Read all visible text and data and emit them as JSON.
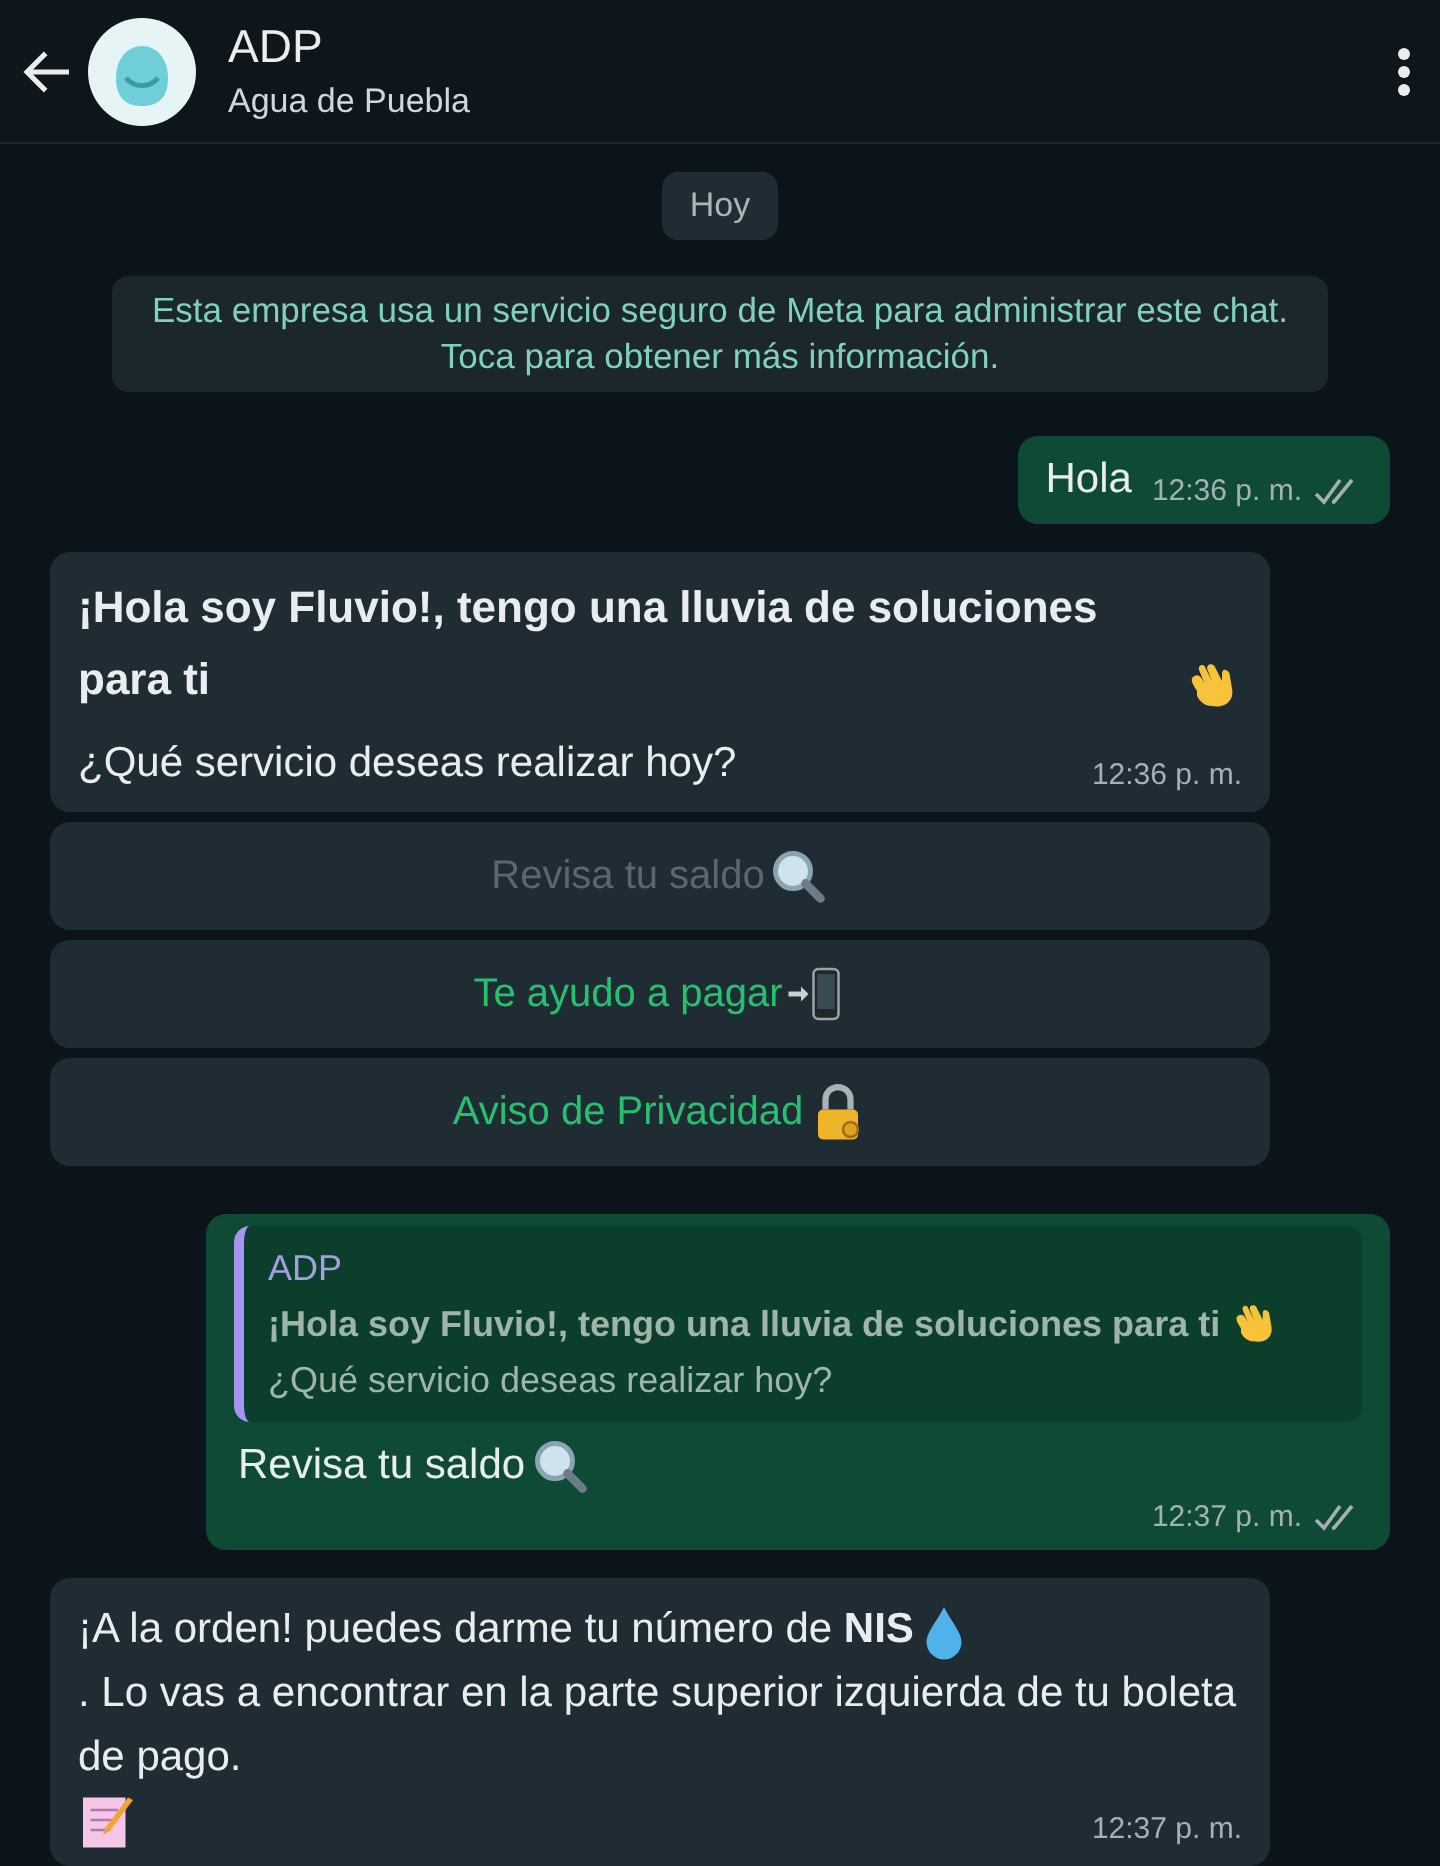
{
  "header": {
    "title": "ADP",
    "subtitle": "Agua de Puebla"
  },
  "date_chip": "Hoy",
  "notice": "Esta empresa usa un servicio seguro de Meta para administrar este chat. Toca para obtener más información.",
  "messages": [
    {
      "kind": "outgoing",
      "parts": [
        {
          "kind": "text",
          "text": "Hola"
        }
      ],
      "time": "12:36 p. m.",
      "read": false
    },
    {
      "kind": "incoming",
      "title_parts": [
        {
          "kind": "text",
          "text": "¡Hola soy Fluvio!, tengo una lluvia de soluciones para ti"
        },
        {
          "kind": "wave"
        }
      ],
      "parts": [
        {
          "kind": "text",
          "text": "¿Qué servicio deseas realizar hoy?"
        }
      ],
      "time": "12:36 p. m."
    },
    {
      "kind": "buttons",
      "buttons": [
        {
          "label": "Revisa tu saldo",
          "kind": "magnifier",
          "disabled": true
        },
        {
          "label": "Te ayudo a pagar",
          "kind": "phone",
          "disabled": false
        },
        {
          "label": "Aviso de Privacidad",
          "kind": "lock",
          "disabled": false
        }
      ]
    },
    {
      "kind": "reply",
      "quote": {
        "author": "ADP",
        "title_parts": [
          {
            "kind": "text",
            "text": "¡Hola soy Fluvio!, tengo una lluvia de soluciones para ti"
          },
          {
            "kind": "wave"
          }
        ],
        "text": "¿Qué servicio deseas realizar hoy?"
      },
      "parts": [
        {
          "kind": "text",
          "text": "Revisa tu saldo"
        },
        {
          "kind": "magnifier"
        }
      ],
      "time": "12:37 p. m.",
      "read": false
    },
    {
      "kind": "incoming",
      "parts": [
        {
          "kind": "text",
          "text": "¡A la orden! puedes darme tu número de **NIS**"
        },
        {
          "kind": "drop"
        },
        {
          "kind": "text",
          "text": ". Lo vas a encontrar en la parte superior izquierda de tu boleta de pago."
        },
        {
          "kind": "memo"
        }
      ],
      "time": "12:37 p. m."
    }
  ]
}
